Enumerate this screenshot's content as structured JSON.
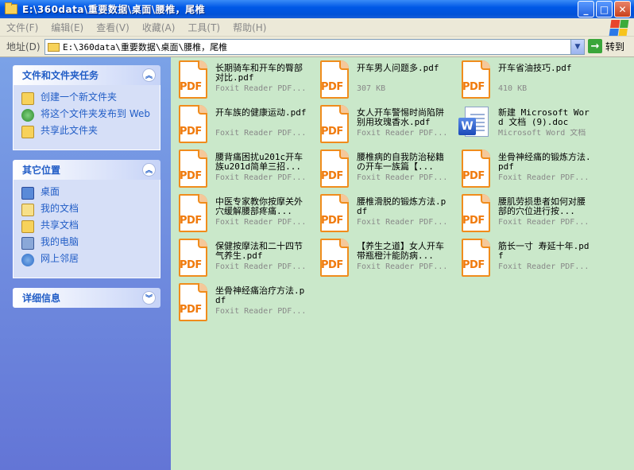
{
  "window": {
    "title": "E:\\360data\\重要数据\\桌面\\腰椎，尾椎"
  },
  "menubar": {
    "items": [
      "文件(F)",
      "编辑(E)",
      "查看(V)",
      "收藏(A)",
      "工具(T)",
      "帮助(H)"
    ]
  },
  "addressbar": {
    "label": "地址(D)",
    "value": "E:\\360data\\重要数据\\桌面\\腰椎，尾椎",
    "go_label": "转到"
  },
  "sidebar": {
    "tasks": {
      "title": "文件和文件夹任务",
      "items": [
        "创建一个新文件夹",
        "将这个文件夹发布到 Web",
        "共享此文件夹"
      ]
    },
    "places": {
      "title": "其它位置",
      "items": [
        "桌面",
        "我的文档",
        "共享文档",
        "我的电脑",
        "网上邻居"
      ]
    },
    "details": {
      "title": "详细信息"
    }
  },
  "files": [
    {
      "name": "长期骑车和开车的臀部对比.pdf",
      "sub": "Foxit Reader PDF...",
      "type": "pdf"
    },
    {
      "name": "开车男人问题多.pdf",
      "sub": "307 KB",
      "type": "pdf"
    },
    {
      "name": "开车省油技巧.pdf",
      "sub": "410 KB",
      "type": "pdf"
    },
    {
      "name": "开车族的健康运动.pdf",
      "sub": "Foxit Reader PDF...",
      "type": "pdf"
    },
    {
      "name": "女人开车警惕时尚陷阱别用玫瑰香水.pdf",
      "sub": "Foxit Reader PDF...",
      "type": "pdf"
    },
    {
      "name": "新建 Microsoft Word 文档 (9).doc",
      "sub": "Microsoft Word 文档",
      "type": "doc"
    },
    {
      "name": "腰背痛困扰u201c开车族u201d简单三招...",
      "sub": "Foxit Reader PDF...",
      "type": "pdf"
    },
    {
      "name": "腰椎病的自我防治秘籍の开车一族篇【...",
      "sub": "Foxit Reader PDF...",
      "type": "pdf"
    },
    {
      "name": "坐骨神经痛的锻炼方法.pdf",
      "sub": "Foxit Reader PDF...",
      "type": "pdf"
    },
    {
      "name": "中医专家教你按摩关外穴缓解腰部疼痛...",
      "sub": "Foxit Reader PDF...",
      "type": "pdf"
    },
    {
      "name": "腰椎滑脱的锻炼方法.pdf",
      "sub": "Foxit Reader PDF...",
      "type": "pdf"
    },
    {
      "name": "腰肌劳损患者如何对腰部的穴位进行按...",
      "sub": "Foxit Reader PDF...",
      "type": "pdf"
    },
    {
      "name": "保健按摩法和二十四节气养生.pdf",
      "sub": "Foxit Reader PDF...",
      "type": "pdf"
    },
    {
      "name": "【养生之道】女人开车带瓶橙汁能防病...",
      "sub": "Foxit Reader PDF...",
      "type": "pdf"
    },
    {
      "name": "筋长一寸 寿延十年.pdf",
      "sub": "Foxit Reader PDF...",
      "type": "pdf"
    },
    {
      "name": "坐骨神经痛治疗方法.pdf",
      "sub": "Foxit Reader PDF...",
      "type": "pdf"
    }
  ],
  "icons": {
    "pdf_label": "PDF",
    "doc_label": "W",
    "toggle_up": "︽",
    "toggle_down": "︾"
  }
}
